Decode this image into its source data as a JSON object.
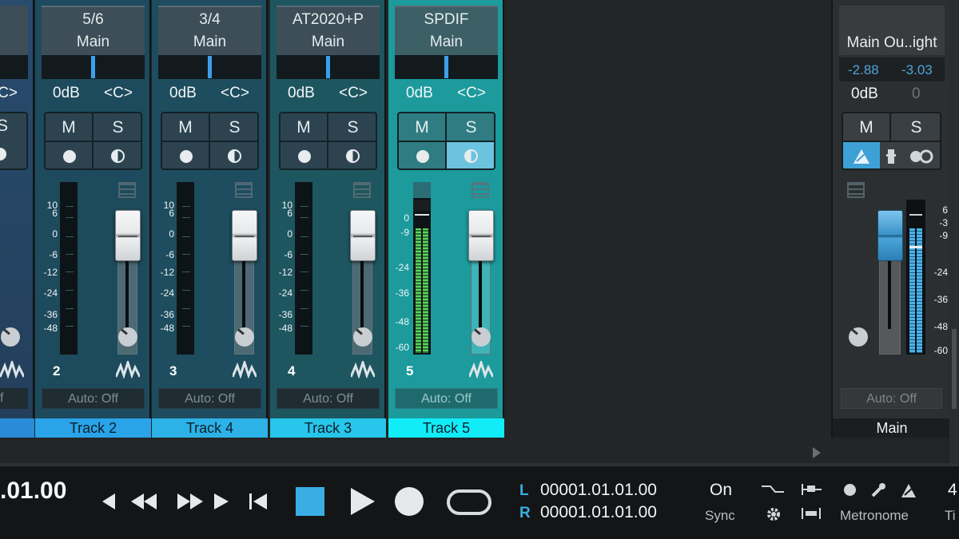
{
  "left_partial": {
    "pan": "<C>",
    "mute": "S",
    "auto": "f"
  },
  "strips": [
    {
      "io": "5/6",
      "bus": "Main",
      "vol": "0dB",
      "pan": "<C>",
      "mute": "M",
      "solo": "S",
      "num": "2",
      "auto": "Auto: Off",
      "name": "Track 2",
      "name_color": "#2aa3e8"
    },
    {
      "io": "3/4",
      "bus": "Main",
      "vol": "0dB",
      "pan": "<C>",
      "mute": "M",
      "solo": "S",
      "num": "3",
      "auto": "Auto: Off",
      "name": "Track 4",
      "name_color": "#2cb2e6"
    },
    {
      "io": "AT2020+P",
      "bus": "Main",
      "vol": "0dB",
      "pan": "<C>",
      "mute": "M",
      "solo": "S",
      "num": "4",
      "auto": "Auto: Off",
      "name": "Track 3",
      "name_color": "#27c6ea"
    },
    {
      "io": "SPDIF",
      "bus": "Main",
      "vol": "0dB",
      "pan": "<C>",
      "mute": "M",
      "solo": "S",
      "num": "5",
      "auto": "Auto: Off",
      "name": "Track 5",
      "name_color": "#12ecf7"
    }
  ],
  "scale_labels": [
    "10",
    "6",
    "0",
    "-6",
    "-12",
    "-24",
    "-36",
    "-48"
  ],
  "scale_labels_active": [
    "0",
    "-9",
    "-24",
    "-36",
    "-48",
    "-60"
  ],
  "main": {
    "io": "Main Ou..ight",
    "peak_l": "-2.88",
    "peak_r": "-3.03",
    "vol": "0dB",
    "pan": "0",
    "mute": "M",
    "solo": "S",
    "auto": "Auto: Off",
    "name": "Main",
    "scale": [
      "6",
      "-3",
      "-9",
      "-24",
      "-36",
      "-48",
      "-60"
    ]
  },
  "transport": {
    "time": ".01.00",
    "loop_l": "L",
    "loop_r": "R",
    "loop_start": "00001.01.01.00",
    "loop_end": "00001.01.01.00",
    "sync_state": "On",
    "sync_label": "Sync",
    "metronome": "Metronome",
    "extra": "4",
    "extra2": "Ti"
  }
}
